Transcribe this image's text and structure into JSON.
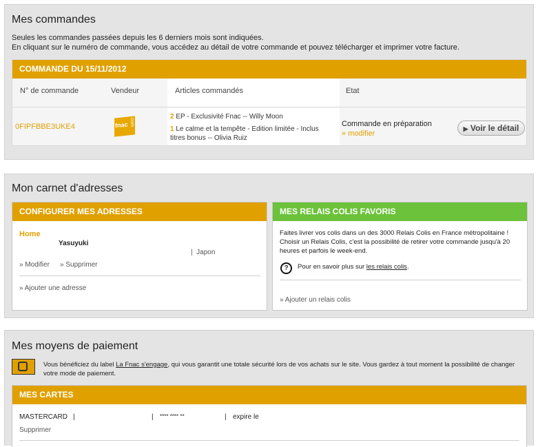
{
  "orders": {
    "title": "Mes commandes",
    "intro_line1": "Seules les commandes passées depuis les 6 derniers mois sont indiquées.",
    "intro_line2": "En cliquant sur le numéro de commande, vous accédez au détail de votre commande et pouvez télécharger et imprimer votre facture.",
    "order_header": "COMMANDE DU 15/11/2012",
    "columns": [
      "N° de commande",
      "Vendeur",
      "Articles commandés",
      "Etat"
    ],
    "order_number": "0FIPFBBE3UKE4",
    "vendor_logo_text": "fnac",
    "vendor_logo_suffix": "com",
    "items": [
      {
        "qty": "2",
        "label": "EP - Exclusivité Fnac -- Willy Moon"
      },
      {
        "qty": "1",
        "label": "Le calme et la tempête - Edition limitée - Inclus titres bonus -- Olivia Ruiz"
      }
    ],
    "status": "Commande en préparation",
    "modify_link": "» modifier",
    "detail_button": "Voir le détail"
  },
  "addresses": {
    "title": "Mon carnet d'adresses",
    "configure_header": "CONFIGURER MES ADRESSES",
    "home_label": "Home",
    "name": "Yasuyuki",
    "country_sep": "|",
    "country": "Japon",
    "modify": "Modifier",
    "delete": "Supprimer",
    "add_address": "Ajouter une adresse",
    "relais_header": "MES RELAIS COLIS FAVORIS",
    "relais_text": "Faites livrer vos colis dans un des 3000 Relais Colis en France métropolitaine ! Choisir un Relais Colis, c'est la possibilité de retirer votre commande jusqu'à 20 heures et parfois le week-end.",
    "relais_more_prefix": "Pour en savoir plus sur ",
    "relais_more_link": "les relais colis",
    "relais_more_suffix": ".",
    "add_relais": "Ajouter un relais colis"
  },
  "payment": {
    "title": "Mes moyens de paiement",
    "secure_text_before": "Vous bénéficiez du label ",
    "secure_link": "La Fnac s'engage",
    "secure_text_after": ", qui vous garantit une totale sécurité lors de vos achats sur le site. Vous gardez à tout moment la possibilité de changer votre mode de paiement.",
    "cards_header": "MES CARTES",
    "card_type": "MASTERCARD",
    "card_number": "**** **** **",
    "expiry_label": "expire le",
    "delete": "Supprimer"
  },
  "colors": {
    "orange": "#e0a000",
    "green": "#6cc23a",
    "panel": "#e4e4e4"
  }
}
